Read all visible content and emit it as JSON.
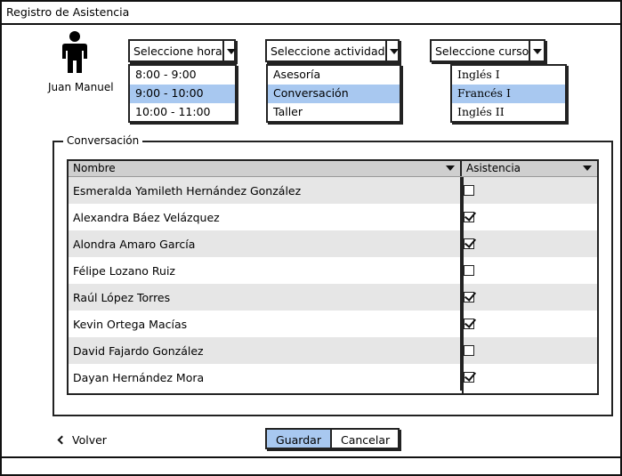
{
  "window": {
    "title": "Registro de Asistencia"
  },
  "user": {
    "name": "Juan Manuel",
    "icon": "person-icon"
  },
  "filters": {
    "hora": {
      "placeholder": "Seleccione hora",
      "options": [
        {
          "label": "8:00 - 9:00",
          "selected": false
        },
        {
          "label": "9:00 - 10:00",
          "selected": true
        },
        {
          "label": "10:00 - 11:00",
          "selected": false
        }
      ]
    },
    "actividad": {
      "placeholder": "Seleccione actividad",
      "options": [
        {
          "label": "Asesoría",
          "selected": false
        },
        {
          "label": "Conversación",
          "selected": true
        },
        {
          "label": "Taller",
          "selected": false
        }
      ]
    },
    "curso": {
      "placeholder": "Seleccione curso",
      "options": [
        {
          "label": "Inglés I",
          "selected": false
        },
        {
          "label": "Francés I",
          "selected": true
        },
        {
          "label": "Inglés II",
          "selected": false
        }
      ]
    }
  },
  "group": {
    "title": "Conversación",
    "columns": {
      "name": "Nombre",
      "attendance": "Asistencia"
    },
    "rows": [
      {
        "name": "Esmeralda Yamileth Hernández González",
        "present": false
      },
      {
        "name": "Alexandra Báez Velázquez",
        "present": true
      },
      {
        "name": "Alondra Amaro García",
        "present": true
      },
      {
        "name": "Félipe Lozano Ruiz",
        "present": false
      },
      {
        "name": "Raúl López Torres",
        "present": true
      },
      {
        "name": "Kevin Ortega Macías",
        "present": true
      },
      {
        "name": "David Fajardo González",
        "present": false
      },
      {
        "name": "Dayan Hernández Mora",
        "present": true
      }
    ]
  },
  "footer": {
    "back_label": "Volver",
    "save_label": "Guardar",
    "cancel_label": "Cancelar"
  },
  "colors": {
    "selection": "#a8c8f0",
    "row_alt": "#e6e6e6",
    "header": "#cfcfcf"
  }
}
